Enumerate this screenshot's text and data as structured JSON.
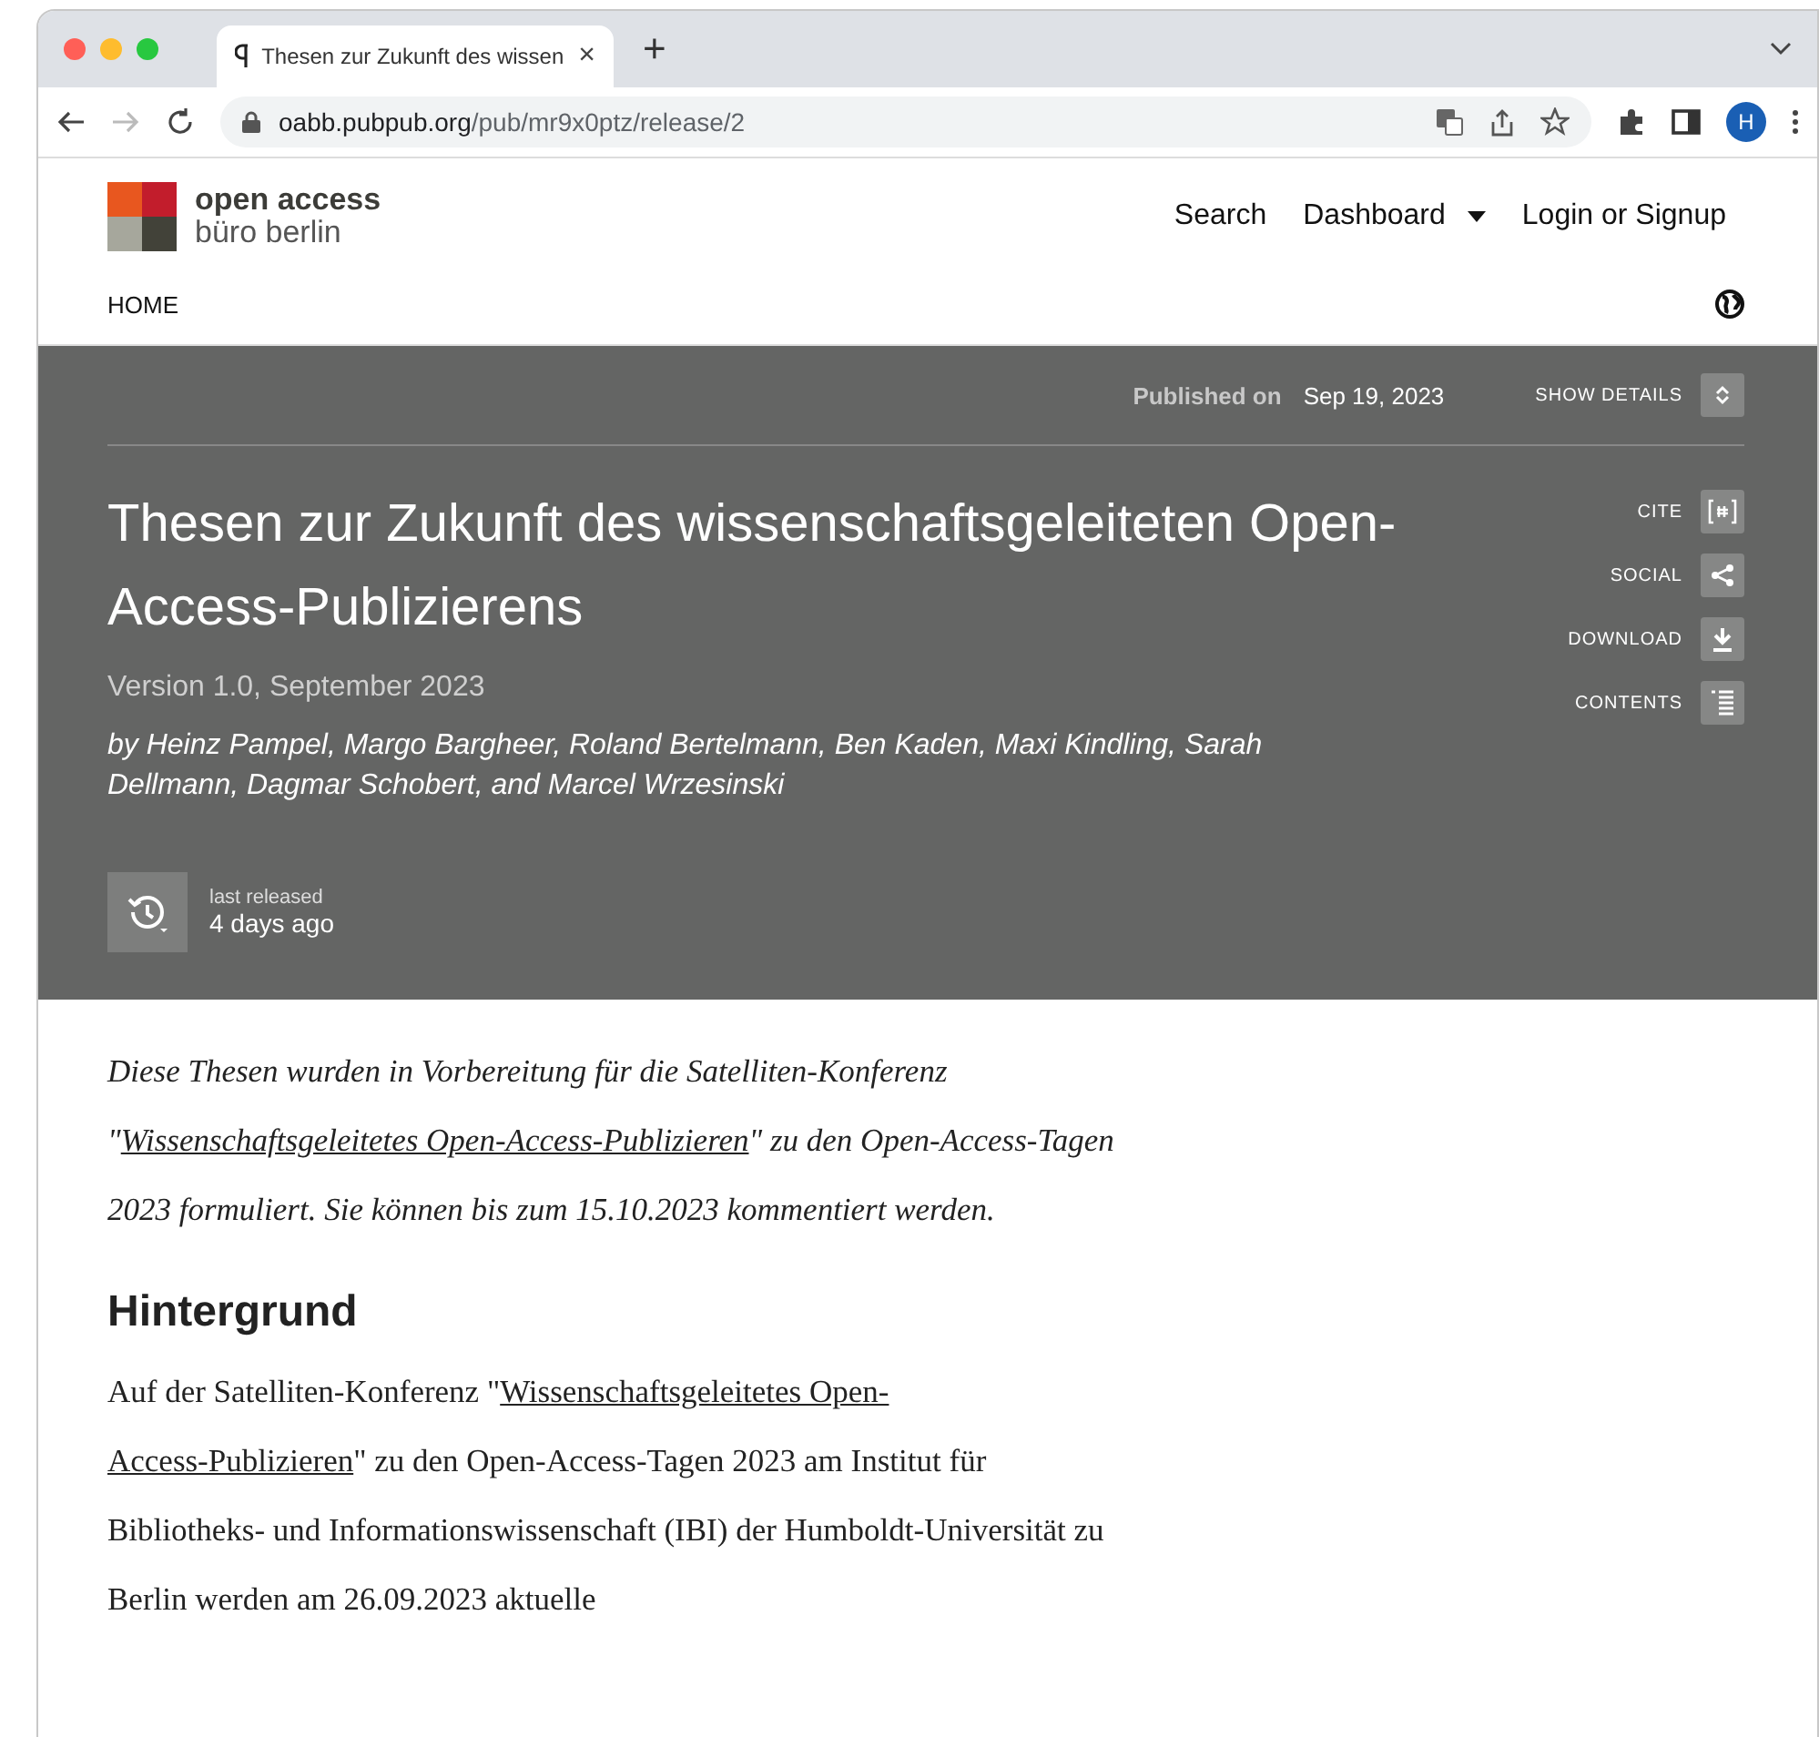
{
  "browser": {
    "tab": {
      "title": "Thesen zur Zukunft des wissen",
      "close": "×"
    },
    "new_tab": "+",
    "url_host": "oabb.pubpub.org",
    "url_path": "/pub/mr9x0ptz/release/2",
    "profile": "H"
  },
  "site": {
    "logo_line1": "open access",
    "logo_line2": "büro berlin",
    "nav": [
      {
        "label": "Search",
        "kind": "link"
      },
      {
        "label": "Dashboard",
        "kind": "dropdown"
      },
      {
        "label": "Login or Signup",
        "kind": "link"
      }
    ],
    "home": "HOME"
  },
  "hero": {
    "published_label": "Published on",
    "published_date": "Sep 19, 2023",
    "show_details": "SHOW DETAILS",
    "title": "Thesen zur Zukunft des wissenschaftsgeleiteten Open-Access-Publizierens",
    "version": "Version 1.0, September 2023",
    "byline": "by Heinz Pampel, Margo Bargheer, Roland Bertelmann, Ben Kaden, Maxi Kindling, Sarah Dellmann, Dagmar Schobert, and Marcel Wrzesinski",
    "actions": [
      {
        "label": "CITE",
        "kind": "cite"
      },
      {
        "label": "SOCIAL",
        "kind": "share"
      },
      {
        "label": "DOWNLOAD",
        "kind": "download"
      },
      {
        "label": "CONTENTS",
        "kind": "contents"
      }
    ],
    "release_label": "last released",
    "release_time": "4 days ago"
  },
  "body": [
    {
      "kind": "intro",
      "segments": [
        {
          "text": "Diese Thesen wurden in Vorbereitung für die Satelliten-Konferenz \""
        },
        {
          "text": "Wissenschaftsgeleitetes Open-Access-Publizieren",
          "link": true
        },
        {
          "text": "\" zu den Open-Access-Tagen 2023 formuliert. Sie können bis zum 15.10.2023 kommentiert werden."
        }
      ]
    },
    {
      "kind": "heading",
      "segments": [
        {
          "text": "Hintergrund"
        }
      ]
    },
    {
      "kind": "paragraph",
      "segments": [
        {
          "text": "Auf der Satelliten-Konferenz \""
        },
        {
          "text": "Wissenschaftsgeleitetes Open-",
          "link": true
        },
        {
          "text": "Access-Publizieren",
          "link": true
        },
        {
          "text": "\" zu den Open-Access-Tagen 2023 am Institut für Bibliotheks- und Informationswissenschaft (IBI) der Humboldt-Universität zu Berlin werden am 26.09.2023 aktuelle"
        }
      ]
    }
  ]
}
